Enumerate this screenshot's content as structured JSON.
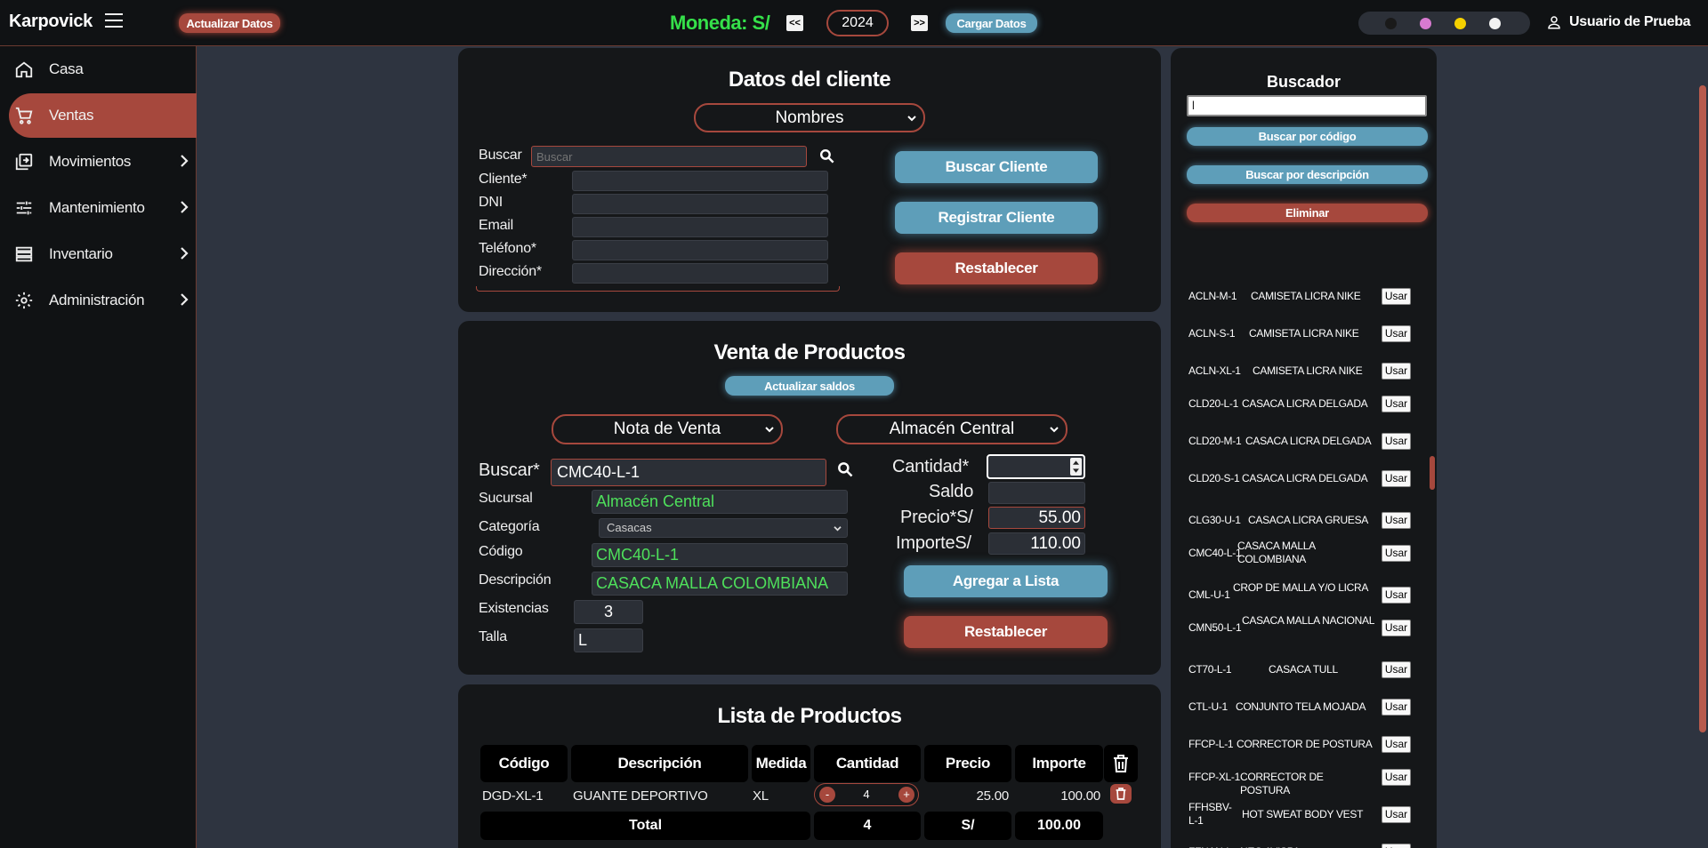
{
  "app": {
    "brand": "Karpovick"
  },
  "topbar": {
    "update_button": "Actualizar Datos",
    "currency": "Moneda: S/",
    "prev": "<<",
    "year": "2024",
    "next": ">>",
    "load_button": "Cargar Datos",
    "theme_colors": [
      "#1a1a1a",
      "#d77ad0",
      "#f5d100",
      "#f2f2f2"
    ],
    "user": "Usuario de Prueba"
  },
  "sidebar": {
    "items": [
      {
        "label": "Casa",
        "icon": "home-icon"
      },
      {
        "label": "Ventas",
        "icon": "cart-icon",
        "active": true
      },
      {
        "label": "Movimientos",
        "icon": "transfer-icon",
        "has_children": true
      },
      {
        "label": "Mantenimiento",
        "icon": "sliders-icon",
        "has_children": true
      },
      {
        "label": "Inventario",
        "icon": "list-icon",
        "has_children": true
      },
      {
        "label": "Administración",
        "icon": "gear-icon",
        "has_children": true
      }
    ]
  },
  "client": {
    "title": "Datos del cliente",
    "search_by": "Nombres",
    "search_label": "Buscar",
    "search_placeholder": "Buscar",
    "labels": [
      "Cliente*",
      "DNI",
      "Email",
      "Teléfono*",
      "Dirección*"
    ],
    "buttons": {
      "search": "Buscar Cliente",
      "register": "Registrar Cliente",
      "reset": "Restablecer"
    }
  },
  "sale": {
    "title": "Venta de Productos",
    "refresh_button": "Actualizar saldos",
    "doc_type": "Nota de Venta",
    "warehouse": "Almacén Central",
    "search_label": "Buscar*",
    "search_value": "CMC40-L-1",
    "sucursal_label": "Sucursal",
    "sucursal_value": "Almacén Central",
    "categoria_label": "Categoría",
    "categoria_value": "Casacas",
    "codigo_label": "Código",
    "codigo_value": "CMC40-L-1",
    "descripcion_label": "Descripción",
    "descripcion_value": "CASACA MALLA COLOMBIANA",
    "existencias_label": "Existencias",
    "existencias_value": "3",
    "talla_label": "Talla",
    "talla_value": "L",
    "cantidad_label": "Cantidad*",
    "saldo_label": "Saldo",
    "precio_label": "Precio*S/",
    "precio_value": "55.00",
    "importe_label": "ImporteS/",
    "importe_value": "110.00",
    "add_button": "Agregar a Lista",
    "reset_button": "Restablecer"
  },
  "products": {
    "title": "Lista de Productos",
    "headers": [
      "Código",
      "Descripción",
      "Medida",
      "Cantidad",
      "Precio",
      "Importe"
    ],
    "rows": [
      {
        "codigo": "DGD-XL-1",
        "descripcion": "GUANTE DEPORTIVO",
        "medida": "XL",
        "cantidad": "4",
        "minus": "-",
        "plus": "+",
        "precio": "25.00",
        "importe": "100.00"
      }
    ],
    "total": {
      "label": "Total",
      "cantidad": "4",
      "currency": "S/",
      "importe": "100.00"
    }
  },
  "finder": {
    "title": "Buscador",
    "input_value": "l",
    "by_code": "Buscar por código",
    "by_desc": "Buscar por descripción",
    "delete": "Eliminar",
    "use_label": "Usar",
    "results": [
      {
        "code": "ACLN-M-1",
        "desc": "CAMISETA LICRA NIKE"
      },
      {
        "code": "ACLN-S-1",
        "desc": "CAMISETA LICRA NIKE"
      },
      {
        "code": "ACLN-XL-1",
        "desc": "CAMISETA LICRA NIKE"
      },
      {
        "code": "CLD20-L-1",
        "desc": "CASACA LICRA DELGADA"
      },
      {
        "code": "CLD20-M-1",
        "desc": "CASACA LICRA DELGADA"
      },
      {
        "code": "CLD20-S-1",
        "desc": "CASACA LICRA DELGADA"
      },
      {
        "code": "CLG30-U-1",
        "desc": "CASACA LICRA GRUESA"
      },
      {
        "code": "CMC40-L-1",
        "desc": "CASACA MALLA COLOMBIANA"
      },
      {
        "code": "CML-U-1",
        "desc": "CROP DE MALLA Y/O LICRA"
      },
      {
        "code": "CMN50-L-1",
        "desc": "CASACA MALLA NACIONAL"
      },
      {
        "code": "CT70-L-1",
        "desc": "CASACA TULL"
      },
      {
        "code": "CTL-U-1",
        "desc": "CONJUNTO TELA MOJADA"
      },
      {
        "code": "FFCP-L-1",
        "desc": "CORRECTOR DE POSTURA"
      },
      {
        "code": "FFCP-XL-1",
        "desc": "CORRECTOR DE POSTURA"
      },
      {
        "code": "FFHSBV-L-1",
        "desc": "HOT SWEAT BODY VEST"
      },
      {
        "code": "FFNAN-L-",
        "desc": "NEO AVISPA"
      }
    ]
  }
}
